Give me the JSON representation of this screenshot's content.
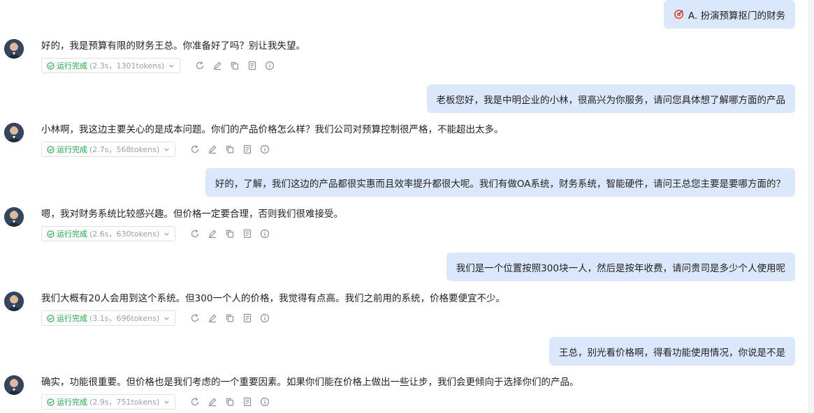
{
  "messages": [
    {
      "role": "user",
      "text": "A. 扮演预算抠门的财务",
      "icon": "target-icon"
    },
    {
      "role": "assistant",
      "text": "好的，我是预算有限的财务王总。你准备好了吗？别让我失望。",
      "status": "运行完成",
      "detail": "(2.3s，1301tokens)"
    },
    {
      "role": "user",
      "text": "老板您好，我是中明企业的小林，很高兴为你服务，请问您具体想了解哪方面的产品"
    },
    {
      "role": "assistant",
      "text": "小林啊，我这边主要关心的是成本问题。你们的产品价格怎么样？我们公司对预算控制很严格，不能超出太多。",
      "status": "运行完成",
      "detail": "(2.7s，568tokens)"
    },
    {
      "role": "user",
      "text": "好的，了解，我们这边的产品都很实惠而且效率提升都很大呢。我们有做OA系统，财务系统，智能硬件，请问王总您主要是要哪方面的？"
    },
    {
      "role": "assistant",
      "text": "嗯，我对财务系统比较感兴趣。但价格一定要合理，否则我们很难接受。",
      "status": "运行完成",
      "detail": "(2.6s，630tokens)"
    },
    {
      "role": "user",
      "text": "我们是一个位置按照300块一人，然后是按年收费，请问贵司是多少个人使用呢"
    },
    {
      "role": "assistant",
      "text": "我们大概有20人会用到这个系统。但300一个人的价格，我觉得有点高。我们之前用的系统，价格要便宜不少。",
      "status": "运行完成",
      "detail": "(3.1s，696tokens)"
    },
    {
      "role": "user",
      "text": "王总，别光看价格啊，得看功能使用情况，你说是不是"
    },
    {
      "role": "assistant",
      "text": "确实，功能很重要。但价格也是我们考虑的一个重要因素。如果你们能在价格上做出一些让步，我们会更倾向于选择你们的产品。",
      "status": "运行完成",
      "detail": "(2.9s，751tokens)"
    }
  ],
  "action_icons": [
    "refresh-icon",
    "edit-icon",
    "copy-icon",
    "notes-icon",
    "info-icon"
  ],
  "colors": {
    "user_bubble": "#dbe8fb",
    "status_green": "#22a34a",
    "muted": "#9aa0a8"
  }
}
